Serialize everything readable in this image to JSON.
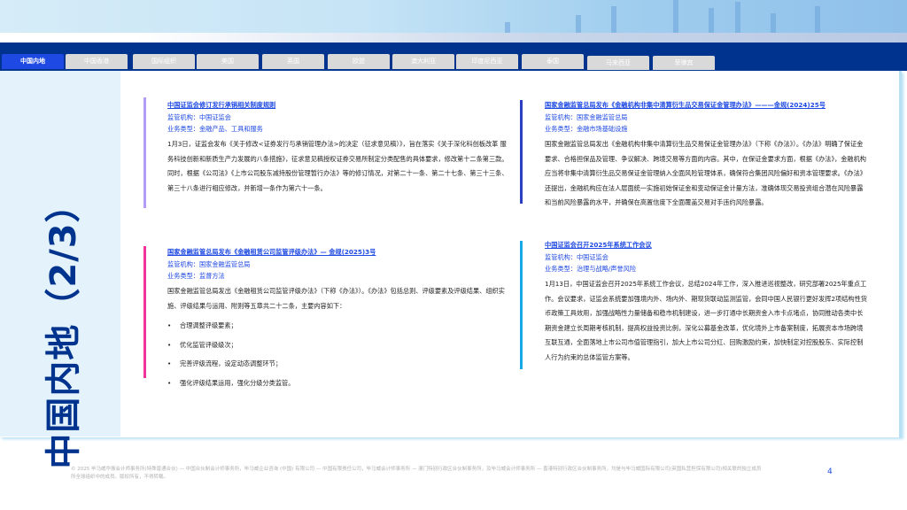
{
  "tabs": [
    "中国内地",
    "中国香港",
    "国际组织",
    "美国",
    "英国",
    "欧盟",
    "澳大利亚",
    "印度尼西亚",
    "泰国",
    "马来西亚",
    "菲律宾"
  ],
  "active_tab": "中国内地",
  "side_title": "中国内地（2/3）",
  "colors": {
    "navy": "#00338d",
    "tab_active": "#1e49e2",
    "accent1": "#b39cf7",
    "accent2": "#f0359a",
    "accent3": "#2b3fc0",
    "accent4": "#18a8e8"
  },
  "articles": [
    {
      "title": "中国证监会修订发行承销相关制度规则",
      "regulator": "监管机构：中国证监会",
      "type": "业务类型：金融产品、工具和服务",
      "body": "1月3日，证监会发布《关于修改<证券发行与承销管理办法>的决定（征求意见稿）》，旨在落实《关于深化科创板改革 服务科技创新和新质生产力发展的八条措施》，征求意见稿授权证券交易所制定分类配售的具体要求，修改第十二条第三款。同时，根据《公司法》《上市公司股东减持股份管理暂行办法》等的修订情况，对第二十一条、第二十七条、第三十三条、第三十八条进行相应修改，并新增一条作为第六十一条。"
    },
    {
      "title": "国家金融监管总局发布《金融租赁公司监管评级办法》— 金规(2025)3号",
      "regulator": "监管机构：国家金融监管总局",
      "type": "业务类型：监督方法",
      "body": "国家金融监管总局发出《金融租赁公司监管评级办法》（下称《办法》）。《办法》包括总则、评级要素及评级结果、组织实施、评级结果与运用、附则等五章共二十二条，主要内容如下：",
      "bullets": [
        "合理调整评级要素；",
        "优化监管评级级次；",
        "完善评级流程，设定动态调整环节；",
        "强化评级结果运用，强化分级分类监管。"
      ]
    },
    {
      "title": "国家金融监管总局发布《金融机构非集中清算衍生品交易保证金管理办法》———金规(2024)25号",
      "regulator": "监管机构：国家金融监管总局",
      "type": "业务类型：金融市场基础设施",
      "body": "国家金融监管总局发出《金融机构非集中清算衍生品交易保证金管理办法》（下称《办法》）。《办法》明确了保证金要求、合格担保品及管理、争议解决、跨境交易等方面的内容。其中，在保证金要求方面，根据《办法》，金融机构应当将非集中清算衍生品交易保证金管理纳入全面风险管理体系，确保符合集团风险偏好和资本管理要求。《办法》还提出，金融机构应在法人层面统一实施初始保证金和变动保证金计量方法，准确体现交易投资组合潜在风险暴露和当前风险暴露的水平，并确保在高置信度下全面覆盖交易对手违约风险暴露。"
    },
    {
      "title": "中国证监会召开2025年系统工作会议",
      "regulator": "监管机构：中国证监会",
      "type": "业务类型：治理与战略/声誉风险",
      "body": "1月13日，中国证监会召开2025年系统工作会议，总结2024年工作，深入推进巡视整改，研究部署2025年重点工作。会议要求，证监会系统要加强境内外、场内外、期现货联动监测监管，会同中国人民银行更好发挥2项结构性货币政策工具效用，加强战略性力量储备和稳市机制建设，进一步打通中长期资金入市卡点堵点，协同推动各类中长期资金建立长周期考核机制，提高权益投资比例，深化公募基金改革，优化境外上市备案制度，拓展资本市场跨境互联互通，全面落地上市公司市值管理指引，加大上市公司分红、回购激励约束，加快制定对控股股东、实际控制人行为约束的总体监管方案等。"
    }
  ],
  "footer": "© 2025 毕马威华振会计师事务所(特殊普通合伙) — 中国合伙制会计师事务所，毕马威企业咨询 (中国) 有限公司 — 中国有限责任公司，毕马威会计师事务所 — 澳门特别行政区合伙制事务所，及毕马威会计师事务所 — 香港特别行政区合伙制事务所，均是与毕马威国际有限公司(英国私营担保有限公司)相关联的独立成员所全球组织中的成员。版权所有，不得转载。",
  "page_number": "4"
}
